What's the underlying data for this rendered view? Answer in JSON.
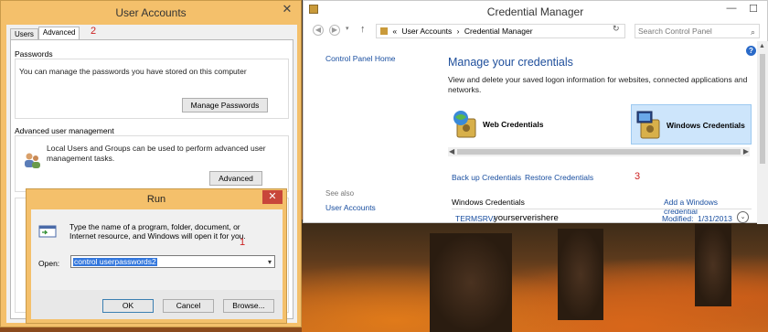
{
  "user_accounts": {
    "title": "User Accounts",
    "close_glyph": "✕",
    "tabs": [
      {
        "label": "Users",
        "active": false
      },
      {
        "label": "Advanced",
        "active": true
      }
    ],
    "step_number": "2",
    "passwords": {
      "heading": "Passwords",
      "text": "You can manage the passwords you have stored on this computer",
      "button": "Manage Passwords"
    },
    "advanced_mgmt": {
      "heading": "Advanced user management",
      "text": "Local Users and Groups can be used to perform advanced user management tasks.",
      "button": "Advanced"
    }
  },
  "run_dialog": {
    "title": "Run",
    "close_glyph": "✕",
    "description": "Type the name of a program, folder, document, or Internet resource, and Windows will open it for you.",
    "step_number": "1",
    "open_label": "Open:",
    "open_value": "control userpasswords2",
    "buttons": {
      "ok": "OK",
      "cancel": "Cancel",
      "browse": "Browse..."
    }
  },
  "credential_manager": {
    "title": "Credential Manager",
    "window_buttons": {
      "minimize": "—",
      "maximize": "☐"
    },
    "breadcrumb": {
      "prefix": "«",
      "items": [
        "User Accounts",
        "Credential Manager"
      ],
      "separator": "›"
    },
    "search_placeholder": "Search Control Panel",
    "sidebar": {
      "home_link": "Control Panel Home",
      "see_also_label": "See also",
      "see_also_link": "User Accounts"
    },
    "heading": "Manage your credentials",
    "subtitle": "View and delete your saved logon information for websites, connected applications and networks.",
    "tiles": [
      {
        "label": "Web Credentials",
        "selected": false
      },
      {
        "label": "Windows Credentials",
        "selected": true
      }
    ],
    "links": {
      "backup": "Back up Credentials",
      "restore": "Restore Credentials"
    },
    "step_number": "3",
    "section_label": "Windows Credentials",
    "add_link": "Add a Windows credential",
    "entry": {
      "prefix": "TERMSRV/",
      "host": "yourserverishere",
      "modified_label": "Modified:",
      "modified_date": "1/31/2013"
    },
    "help_glyph": "?"
  },
  "accent_colors": {
    "window_frame": "#f4c06b",
    "link_blue": "#1a4fa0",
    "heading_blue": "#1e4e9b",
    "annotation_red": "#cc2222"
  }
}
